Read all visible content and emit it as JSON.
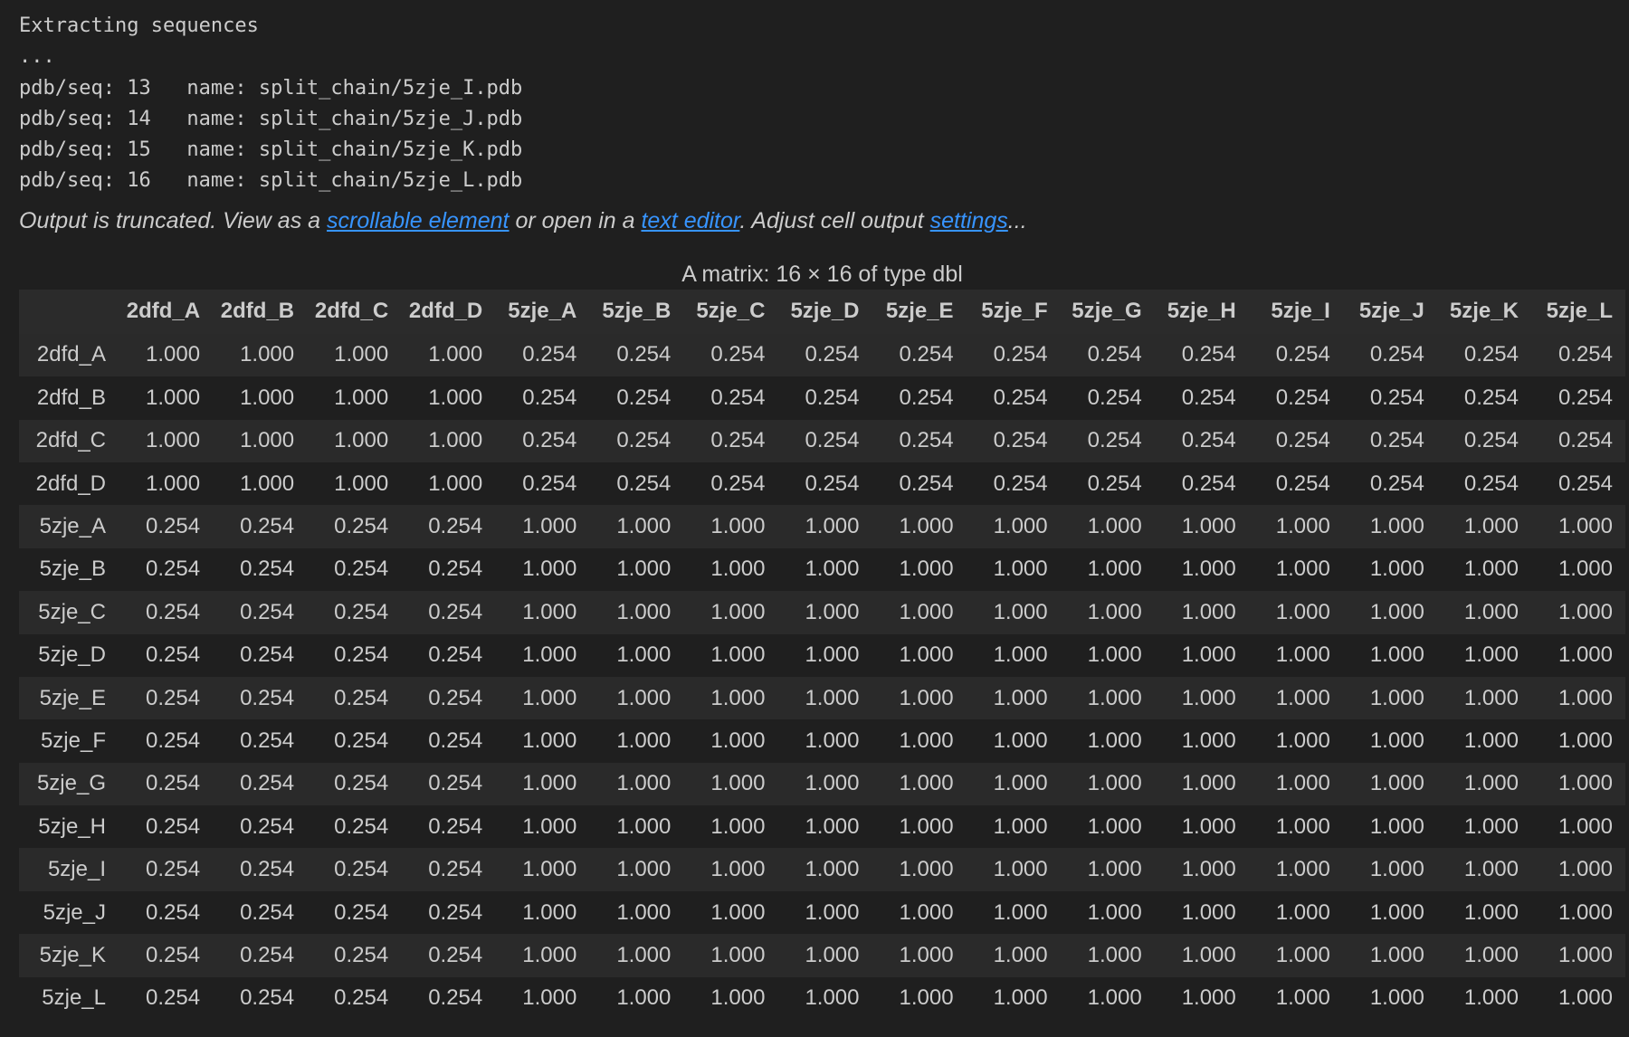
{
  "console": {
    "lines": [
      "Extracting sequences",
      "...",
      "pdb/seq: 13   name: split_chain/5zje_I.pdb",
      "pdb/seq: 14   name: split_chain/5zje_J.pdb",
      "pdb/seq: 15   name: split_chain/5zje_K.pdb",
      "pdb/seq: 16   name: split_chain/5zje_L.pdb"
    ]
  },
  "truncation_notice": {
    "prefix": "Output is truncated. View as a ",
    "link_scrollable": "scrollable element",
    "middle": " or open in a ",
    "link_text_editor": "text editor",
    "middle2": ". Adjust cell output ",
    "link_settings": "settings",
    "suffix": "..."
  },
  "matrix": {
    "caption": "A matrix: 16 × 16 of type dbl",
    "columns": [
      "2dfd_A",
      "2dfd_B",
      "2dfd_C",
      "2dfd_D",
      "5zje_A",
      "5zje_B",
      "5zje_C",
      "5zje_D",
      "5zje_E",
      "5zje_F",
      "5zje_G",
      "5zje_H",
      "5zje_I",
      "5zje_J",
      "5zje_K",
      "5zje_L"
    ],
    "rows": [
      {
        "name": "2dfd_A",
        "values": [
          "1.000",
          "1.000",
          "1.000",
          "1.000",
          "0.254",
          "0.254",
          "0.254",
          "0.254",
          "0.254",
          "0.254",
          "0.254",
          "0.254",
          "0.254",
          "0.254",
          "0.254",
          "0.254"
        ]
      },
      {
        "name": "2dfd_B",
        "values": [
          "1.000",
          "1.000",
          "1.000",
          "1.000",
          "0.254",
          "0.254",
          "0.254",
          "0.254",
          "0.254",
          "0.254",
          "0.254",
          "0.254",
          "0.254",
          "0.254",
          "0.254",
          "0.254"
        ]
      },
      {
        "name": "2dfd_C",
        "values": [
          "1.000",
          "1.000",
          "1.000",
          "1.000",
          "0.254",
          "0.254",
          "0.254",
          "0.254",
          "0.254",
          "0.254",
          "0.254",
          "0.254",
          "0.254",
          "0.254",
          "0.254",
          "0.254"
        ]
      },
      {
        "name": "2dfd_D",
        "values": [
          "1.000",
          "1.000",
          "1.000",
          "1.000",
          "0.254",
          "0.254",
          "0.254",
          "0.254",
          "0.254",
          "0.254",
          "0.254",
          "0.254",
          "0.254",
          "0.254",
          "0.254",
          "0.254"
        ]
      },
      {
        "name": "5zje_A",
        "values": [
          "0.254",
          "0.254",
          "0.254",
          "0.254",
          "1.000",
          "1.000",
          "1.000",
          "1.000",
          "1.000",
          "1.000",
          "1.000",
          "1.000",
          "1.000",
          "1.000",
          "1.000",
          "1.000"
        ]
      },
      {
        "name": "5zje_B",
        "values": [
          "0.254",
          "0.254",
          "0.254",
          "0.254",
          "1.000",
          "1.000",
          "1.000",
          "1.000",
          "1.000",
          "1.000",
          "1.000",
          "1.000",
          "1.000",
          "1.000",
          "1.000",
          "1.000"
        ]
      },
      {
        "name": "5zje_C",
        "values": [
          "0.254",
          "0.254",
          "0.254",
          "0.254",
          "1.000",
          "1.000",
          "1.000",
          "1.000",
          "1.000",
          "1.000",
          "1.000",
          "1.000",
          "1.000",
          "1.000",
          "1.000",
          "1.000"
        ]
      },
      {
        "name": "5zje_D",
        "values": [
          "0.254",
          "0.254",
          "0.254",
          "0.254",
          "1.000",
          "1.000",
          "1.000",
          "1.000",
          "1.000",
          "1.000",
          "1.000",
          "1.000",
          "1.000",
          "1.000",
          "1.000",
          "1.000"
        ]
      },
      {
        "name": "5zje_E",
        "values": [
          "0.254",
          "0.254",
          "0.254",
          "0.254",
          "1.000",
          "1.000",
          "1.000",
          "1.000",
          "1.000",
          "1.000",
          "1.000",
          "1.000",
          "1.000",
          "1.000",
          "1.000",
          "1.000"
        ]
      },
      {
        "name": "5zje_F",
        "values": [
          "0.254",
          "0.254",
          "0.254",
          "0.254",
          "1.000",
          "1.000",
          "1.000",
          "1.000",
          "1.000",
          "1.000",
          "1.000",
          "1.000",
          "1.000",
          "1.000",
          "1.000",
          "1.000"
        ]
      },
      {
        "name": "5zje_G",
        "values": [
          "0.254",
          "0.254",
          "0.254",
          "0.254",
          "1.000",
          "1.000",
          "1.000",
          "1.000",
          "1.000",
          "1.000",
          "1.000",
          "1.000",
          "1.000",
          "1.000",
          "1.000",
          "1.000"
        ]
      },
      {
        "name": "5zje_H",
        "values": [
          "0.254",
          "0.254",
          "0.254",
          "0.254",
          "1.000",
          "1.000",
          "1.000",
          "1.000",
          "1.000",
          "1.000",
          "1.000",
          "1.000",
          "1.000",
          "1.000",
          "1.000",
          "1.000"
        ]
      },
      {
        "name": "5zje_I",
        "values": [
          "0.254",
          "0.254",
          "0.254",
          "0.254",
          "1.000",
          "1.000",
          "1.000",
          "1.000",
          "1.000",
          "1.000",
          "1.000",
          "1.000",
          "1.000",
          "1.000",
          "1.000",
          "1.000"
        ]
      },
      {
        "name": "5zje_J",
        "values": [
          "0.254",
          "0.254",
          "0.254",
          "0.254",
          "1.000",
          "1.000",
          "1.000",
          "1.000",
          "1.000",
          "1.000",
          "1.000",
          "1.000",
          "1.000",
          "1.000",
          "1.000",
          "1.000"
        ]
      },
      {
        "name": "5zje_K",
        "values": [
          "0.254",
          "0.254",
          "0.254",
          "0.254",
          "1.000",
          "1.000",
          "1.000",
          "1.000",
          "1.000",
          "1.000",
          "1.000",
          "1.000",
          "1.000",
          "1.000",
          "1.000",
          "1.000"
        ]
      },
      {
        "name": "5zje_L",
        "values": [
          "0.254",
          "0.254",
          "0.254",
          "0.254",
          "1.000",
          "1.000",
          "1.000",
          "1.000",
          "1.000",
          "1.000",
          "1.000",
          "1.000",
          "1.000",
          "1.000",
          "1.000",
          "1.000"
        ]
      }
    ]
  },
  "colors": {
    "background": "#1f1f1f",
    "text": "#cccccc",
    "link": "#3794ff",
    "stripe": "#2a2a2a"
  }
}
